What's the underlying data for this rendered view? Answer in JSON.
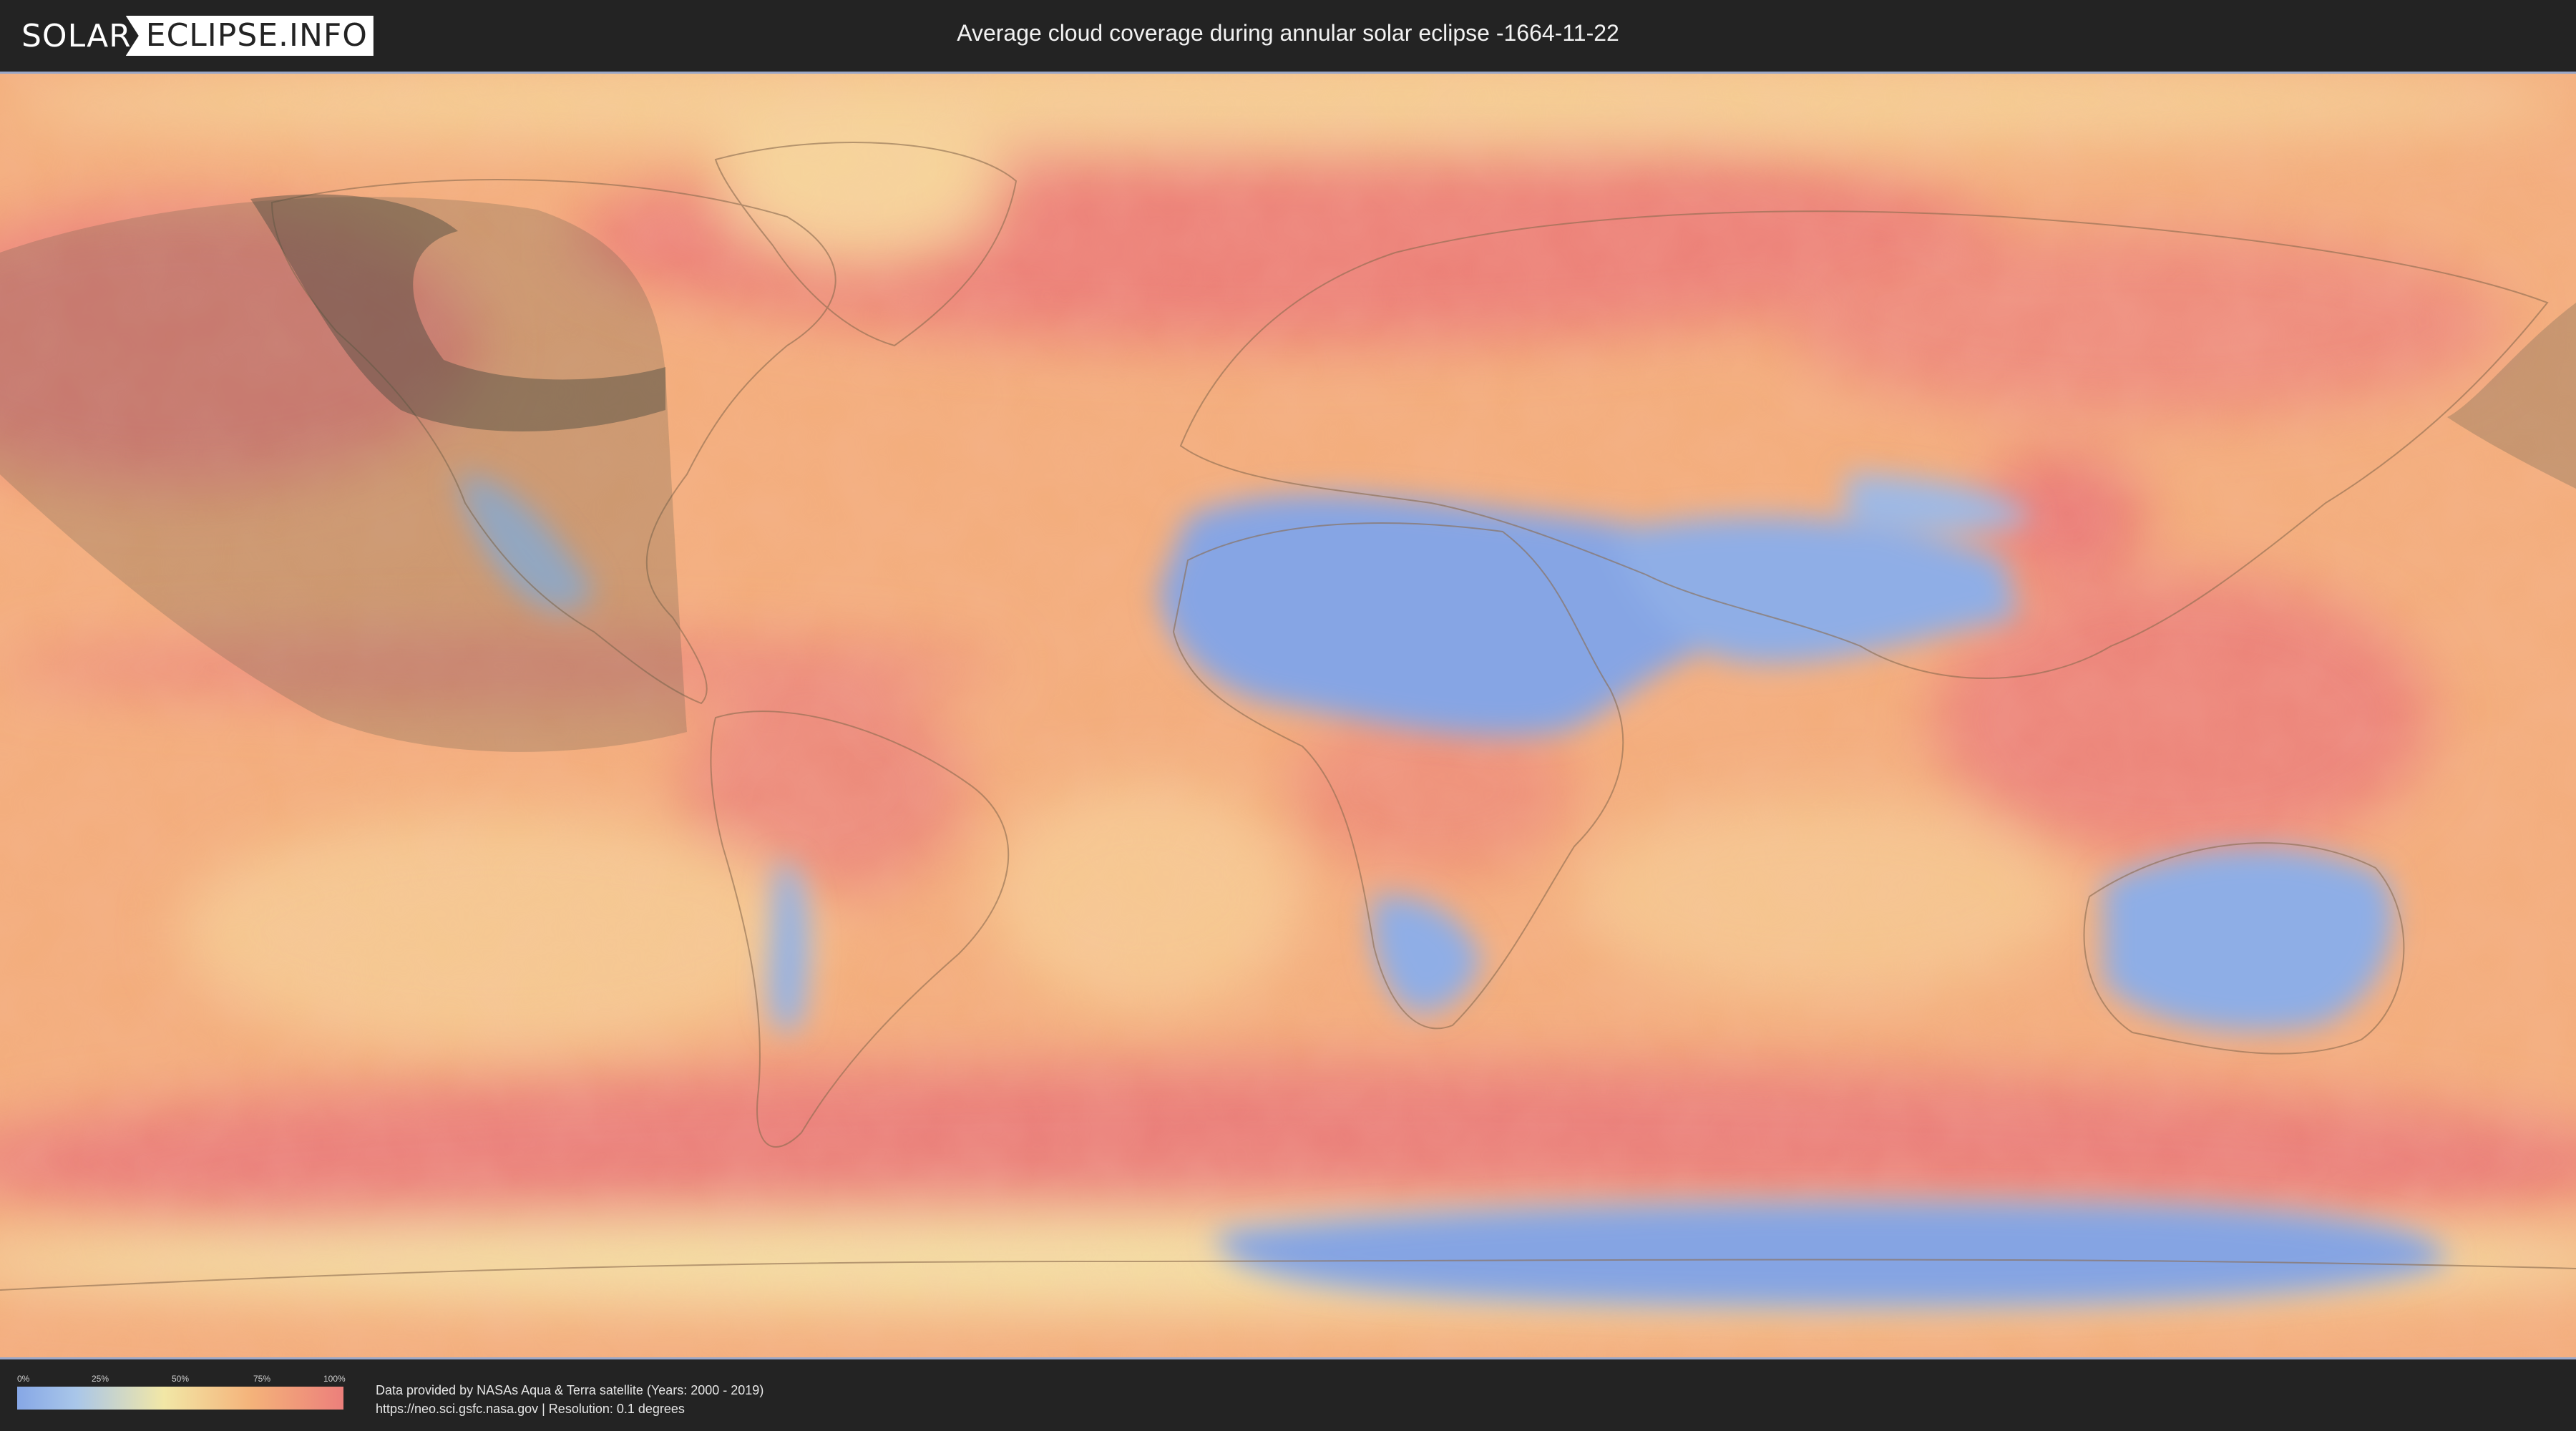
{
  "header": {
    "logo_left": "SOLAR",
    "logo_right": "ECLIPSE.INFO",
    "title": "Average cloud coverage during annular solar eclipse -1664-11-22"
  },
  "map": {
    "layer": "cloud coverage",
    "colors": {
      "clear": "#86a7e6",
      "low": "#a9c6e9",
      "mid": "#f2e7a6",
      "high": "#f4b27a",
      "overcast": "#ec7f7b",
      "eclipse_path": "#5b5a4c",
      "land_border": "#8a6b4f"
    }
  },
  "footer": {
    "legend": {
      "ticks": [
        "0%",
        "25%",
        "50%",
        "75%",
        "100%"
      ]
    },
    "credit_line1": "Data provided by NASAs Aqua & Terra satellite (Years: 2000 - 2019)",
    "credit_line2": "https://neo.sci.gsfc.nasa.gov | Resolution: 0.1 degrees"
  }
}
